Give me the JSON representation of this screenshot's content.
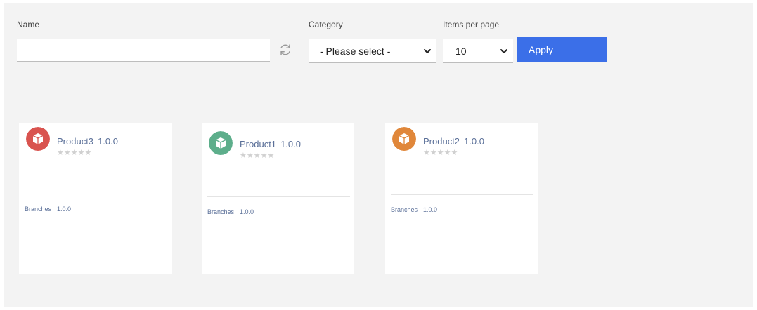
{
  "filters": {
    "name_label": "Name",
    "name_value": "",
    "category_label": "Category",
    "category_selected": "- Please select -",
    "items_per_page_label": "Items per page",
    "items_per_page_selected": "10",
    "apply_label": "Apply"
  },
  "products": [
    {
      "name": "Product3",
      "version": "1.0.0",
      "stars": "★★★★★",
      "branches_label": "Branches",
      "branch_version": "1.0.0",
      "logo_color": "#d9534f"
    },
    {
      "name": "Product1",
      "version": "1.0.0",
      "stars": "★★★★★",
      "branches_label": "Branches",
      "branch_version": "1.0.0",
      "logo_color": "#5dae8b"
    },
    {
      "name": "Product2",
      "version": "1.0.0",
      "stars": "★★★★★",
      "branches_label": "Branches",
      "branch_version": "1.0.0",
      "logo_color": "#e0873a"
    }
  ],
  "colors": {
    "accent": "#3b6fe8",
    "background": "#f3f3f3",
    "link": "#5a6f98"
  },
  "icons": {
    "refresh": "refresh-icon",
    "chevron": "chevron-down-icon",
    "product": "package-icon"
  }
}
